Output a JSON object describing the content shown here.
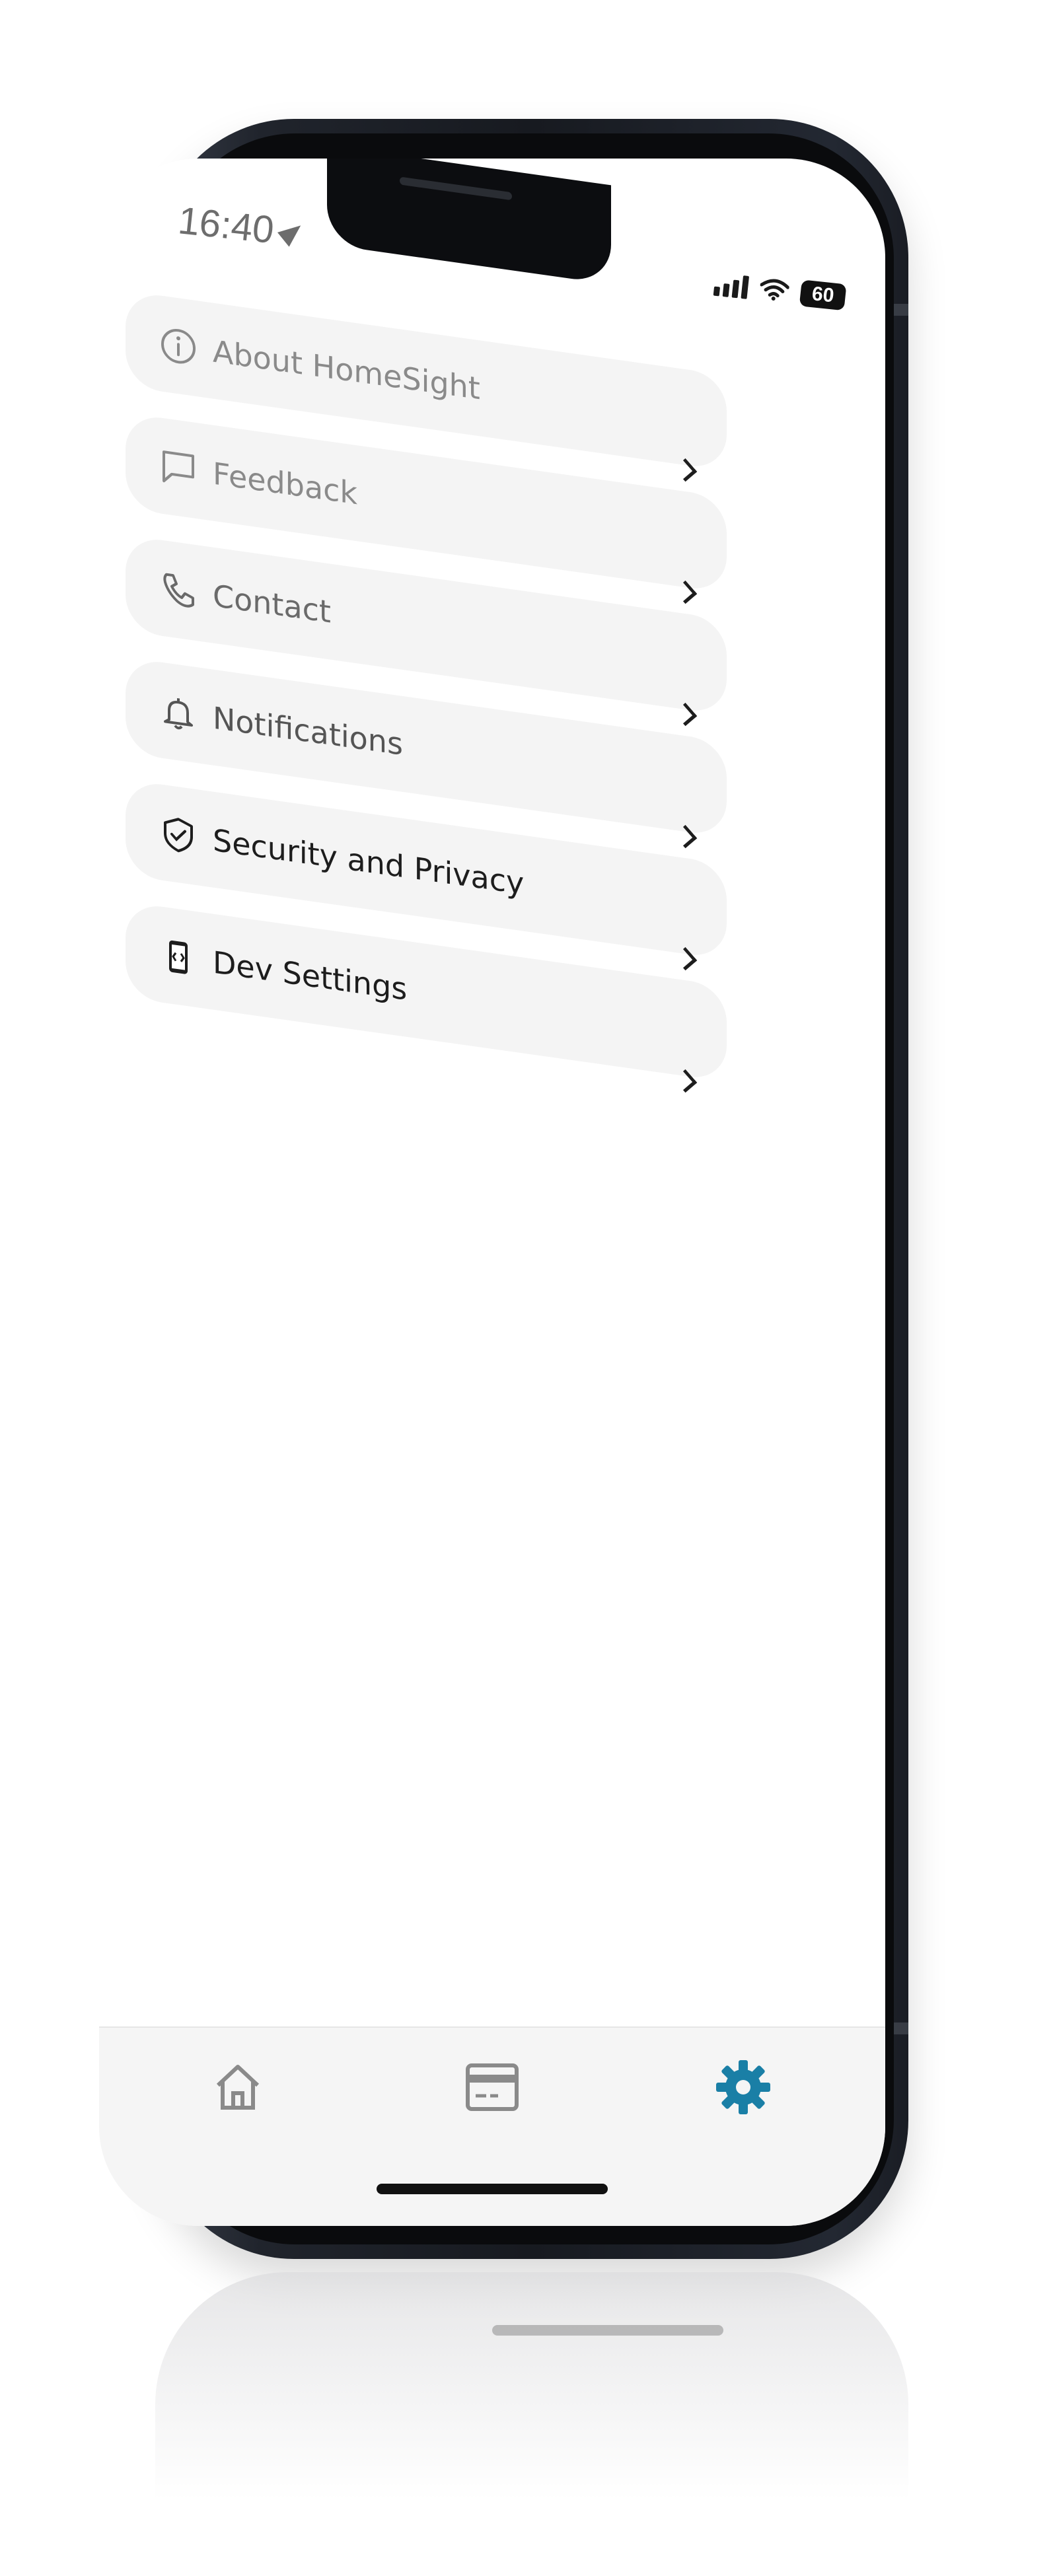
{
  "status_bar": {
    "time": "16:40",
    "battery": "60",
    "icons": [
      "location-arrow-icon",
      "cellular-signal-icon",
      "wifi-icon",
      "battery-icon"
    ]
  },
  "settings": {
    "items": [
      {
        "label": "About HomeSight",
        "icon": "info-icon",
        "color": "#8a8a8a"
      },
      {
        "label": "Feedback",
        "icon": "message-icon",
        "color": "#8a8a8a"
      },
      {
        "label": "Contact",
        "icon": "phone-icon",
        "color": "#6a6a6a"
      },
      {
        "label": "Notifications",
        "icon": "bell-icon",
        "color": "#555555"
      },
      {
        "label": "Security and Privacy",
        "icon": "shield-check-icon",
        "color": "#1d1d1d"
      },
      {
        "label": "Dev Settings",
        "icon": "dev-phone-icon",
        "color": "#1d1d1d"
      }
    ]
  },
  "tabbar": {
    "tabs": [
      {
        "name": "home",
        "icon": "home-icon",
        "active": false
      },
      {
        "name": "card",
        "icon": "card-icon",
        "active": false
      },
      {
        "name": "settings",
        "icon": "gear-icon",
        "active": true
      }
    ],
    "accent_color": "#1a7fa6",
    "inactive_color": "#8a8a8a"
  }
}
